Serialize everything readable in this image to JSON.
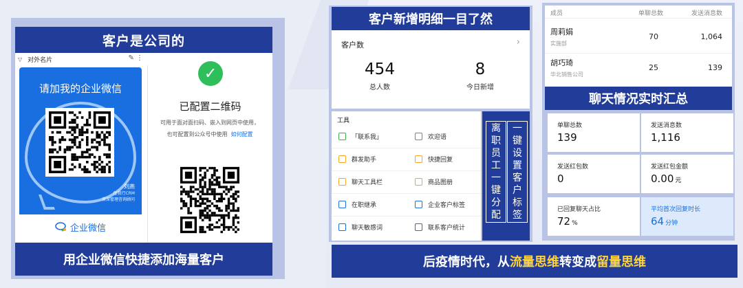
{
  "left": {
    "title": "客户是公司的",
    "footer": "用企业微信快捷添加海量客户",
    "card_header": "对外名片",
    "wecard_title": "请加我的企业微信",
    "person_name": "刘燕",
    "person_line1": "任我行CRM",
    "person_line2": "资深管理咨询顾问",
    "wecard_brand": "企业微信",
    "configured_title": "已配置二维码",
    "configured_desc_1": "可用于面对面扫码、嵌入到网页中使用，",
    "configured_desc_2": "也可配置到公众号中使用",
    "configured_link": "如何配置"
  },
  "middle": {
    "title": "客户新增明细一目了然",
    "stat_header": "客户数",
    "total": "454",
    "total_label": "总人数",
    "today": "8",
    "today_label": "今日新增",
    "tools_header": "工具",
    "tools": [
      {
        "label": "「联系我」",
        "icon": "contact-me-icon",
        "color": "#3bb34a"
      },
      {
        "label": "欢迎语",
        "icon": "welcome-icon",
        "color": "#3bb34a"
      },
      {
        "label": "群发助手",
        "icon": "broadcast-icon",
        "color": "#f5a623"
      },
      {
        "label": "快捷回复",
        "icon": "quick-reply-icon",
        "color": "#f5a623"
      },
      {
        "label": "聊天工具栏",
        "icon": "chat-toolbar-icon",
        "color": "#f5a623"
      },
      {
        "label": "商品图册",
        "icon": "product-album-icon",
        "color": "#f5a623"
      },
      {
        "label": "在职继承",
        "icon": "inherit-icon",
        "color": "#1a6fe0"
      },
      {
        "label": "企业客户标签",
        "icon": "tag-icon",
        "color": "#1a6fe0"
      },
      {
        "label": "聊天敏感词",
        "icon": "sensitive-words-icon",
        "color": "#1a6fe0"
      },
      {
        "label": "联系客户统计",
        "icon": "statistics-icon",
        "color": "#1a6fe0"
      }
    ],
    "vbox_left": "离职员工一键分配",
    "vbox_right": "一键设置客户标签"
  },
  "right": {
    "columns": [
      "成员",
      "单聊总数",
      "发送消息数"
    ],
    "rows": [
      {
        "name": "周莉娟",
        "dept": "实施部",
        "chats": "70",
        "messages": "1,064"
      },
      {
        "name": "胡巧琦",
        "dept": "华北销售公司",
        "chats": "25",
        "messages": "139"
      }
    ],
    "title": "聊天情况实时汇总",
    "cards": [
      {
        "label": "单聊总数",
        "value": "139",
        "unit": ""
      },
      {
        "label": "发送消息数",
        "value": "1,116",
        "unit": ""
      },
      {
        "label": "发送红包数",
        "value": "0",
        "unit": ""
      },
      {
        "label": "发送红包金额",
        "value": "0.00",
        "unit": "元"
      },
      {
        "label": "已回复聊天占比",
        "value": "72",
        "unit": "%"
      },
      {
        "label": "平均首次回复时长",
        "value": "64",
        "unit": "分钟"
      }
    ]
  },
  "banner": {
    "part1": "后疫情时代，从",
    "hl1": "流量思维",
    "part2": "转变成",
    "hl2": "留量思维"
  },
  "colors": {
    "navy": "#223d99",
    "frame": "#b8c3e6",
    "wechat_blue": "#1a6fe0",
    "success_green": "#2fbf5a",
    "highlight_yellow": "#ffd43b"
  }
}
